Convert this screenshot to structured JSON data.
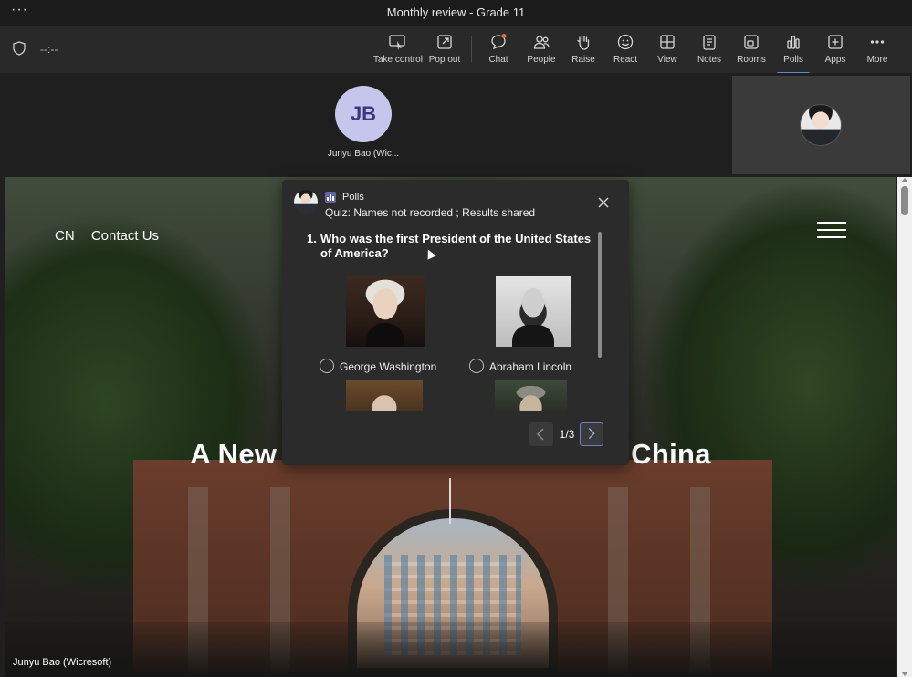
{
  "window": {
    "title": "Monthly review - Grade 11",
    "menu_glyph": "···"
  },
  "toolbar": {
    "timer": "--:--",
    "buttons": [
      {
        "id": "take-control",
        "label": "Take control",
        "icon": "take-control-icon"
      },
      {
        "id": "pop-out",
        "label": "Pop out",
        "icon": "pop-out-icon"
      },
      {
        "id": "chat",
        "label": "Chat",
        "icon": "chat-icon"
      },
      {
        "id": "people",
        "label": "People",
        "icon": "people-icon"
      },
      {
        "id": "raise",
        "label": "Raise",
        "icon": "raise-hand-icon"
      },
      {
        "id": "react",
        "label": "React",
        "icon": "smiley-icon"
      },
      {
        "id": "view",
        "label": "View",
        "icon": "grid-view-icon"
      },
      {
        "id": "notes",
        "label": "Notes",
        "icon": "notes-icon"
      },
      {
        "id": "rooms",
        "label": "Rooms",
        "icon": "rooms-icon"
      },
      {
        "id": "polls",
        "label": "Polls",
        "icon": "polls-icon",
        "active": true
      },
      {
        "id": "apps",
        "label": "Apps",
        "icon": "apps-icon"
      },
      {
        "id": "more",
        "label": "More",
        "icon": "more-icon"
      }
    ]
  },
  "participants": {
    "main": {
      "initials": "JB",
      "name": "Junyu Bao (Wic..."
    }
  },
  "shared_screen": {
    "nav": [
      "CN",
      "Contact Us"
    ],
    "headline_left": "A New",
    "headline_right": "China",
    "presenter_label": "Junyu Bao (Wicresoft)"
  },
  "poll": {
    "app_name": "Polls",
    "subtitle": "Quiz: Names not recorded ; Results shared",
    "question_number": "1.",
    "question_text": "Who was the first President of the United States of America?",
    "options": [
      {
        "label": "George Washington",
        "selected": false
      },
      {
        "label": "Abraham Lincoln",
        "selected": false
      }
    ],
    "page_indicator": "1/3"
  },
  "colors": {
    "accent": "#5b8bd8",
    "avatar_bg": "#c6c5ec",
    "avatar_text": "#3a3783",
    "polls_brand": "#6264a7"
  }
}
